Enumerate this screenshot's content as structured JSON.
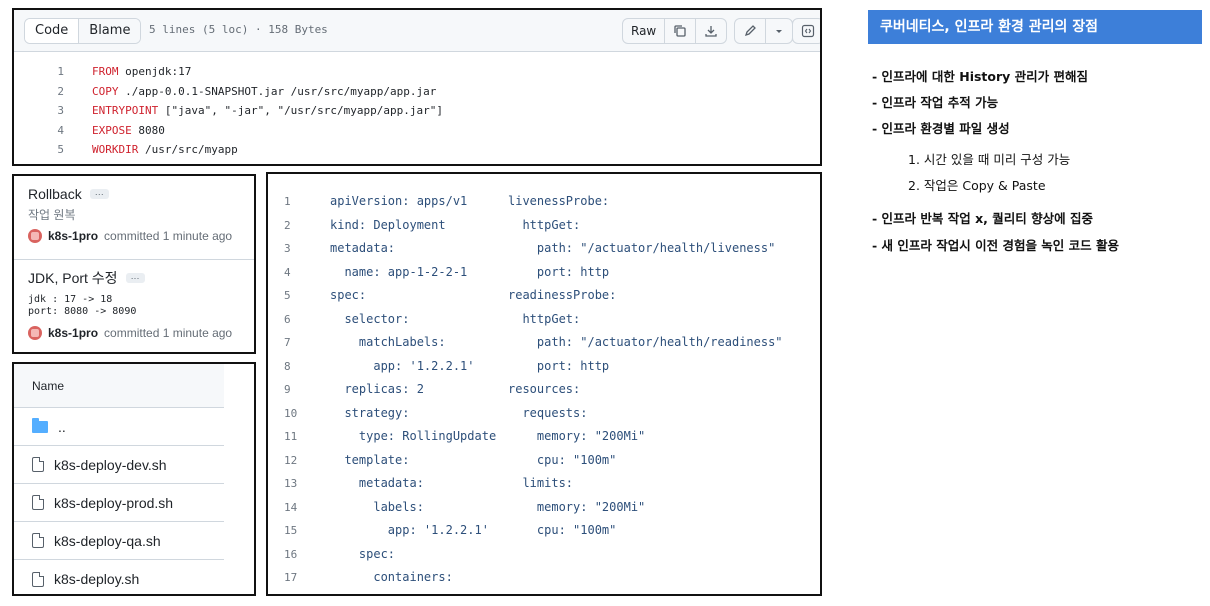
{
  "code_view": {
    "tab_code": "Code",
    "tab_blame": "Blame",
    "meta": "5 lines (5 loc) · 158 Bytes",
    "raw_label": "Raw",
    "lines": [
      {
        "num": "1",
        "kw": "FROM",
        "rest": " openjdk:17"
      },
      {
        "num": "2",
        "kw": "COPY",
        "rest": " ./app-0.0.1-SNAPSHOT.jar /usr/src/myapp/app.jar"
      },
      {
        "num": "3",
        "kw": "ENTRYPOINT",
        "rest": " [\"java\", \"-jar\", \"/usr/src/myapp/app.jar\"]"
      },
      {
        "num": "4",
        "kw": "EXPOSE",
        "rest": " 8080"
      },
      {
        "num": "5",
        "kw": "WORKDIR",
        "rest": " /usr/src/myapp"
      }
    ]
  },
  "commits": [
    {
      "title": "Rollback",
      "desc": "작업 원복",
      "author": "k8s-1pro",
      "time": "committed 1 minute ago"
    },
    {
      "title": "JDK, Port 수정",
      "desc": "jdk : 17 -> 18\nport: 8080 -> 8090",
      "author": "k8s-1pro",
      "time": "committed 1 minute ago"
    }
  ],
  "files": {
    "header": "Name",
    "parent": "..",
    "items": [
      "k8s-deploy-dev.sh",
      "k8s-deploy-prod.sh",
      "k8s-deploy-qa.sh",
      "k8s-deploy.sh"
    ]
  },
  "yaml_left": {
    "line_numbers": [
      "1",
      "2",
      "3",
      "4",
      "5",
      "6",
      "7",
      "8",
      "9",
      "10",
      "11",
      "12",
      "13",
      "14",
      "15",
      "16",
      "17"
    ],
    "lines": [
      "apiVersion: apps/v1",
      "kind: Deployment",
      "metadata:",
      "  name: app-1-2-2-1",
      "spec:",
      "  selector:",
      "    matchLabels:",
      "      app: '1.2.2.1'",
      "  replicas: 2",
      "  strategy:",
      "    type: RollingUpdate",
      "  template:",
      "    metadata:",
      "      labels:",
      "        app: '1.2.2.1'",
      "    spec:",
      "      containers:"
    ]
  },
  "yaml_right": {
    "lines": [
      "livenessProbe:",
      "  httpGet:",
      "    path: \"/actuator/health/liveness\"",
      "    port: http",
      "readinessProbe:",
      "  httpGet:",
      "    path: \"/actuator/health/readiness\"",
      "    port: http",
      "resources:",
      "  requests:",
      "    memory: \"200Mi\"",
      "    cpu: \"100m\"",
      "  limits:",
      "    memory: \"200Mi\"",
      "    cpu: \"100m\""
    ]
  },
  "notes": {
    "title": "쿠버네티스, 인프라 환경 관리의 장점",
    "items": [
      "- 인프라에 대한 History 관리가 편해짐",
      "- 인프라 작업 추적 가능",
      "- 인프라 환경별 파일 생성",
      "1. 시간 있을 때 미리 구성 가능",
      "2. 작업은 Copy & Paste",
      "- 인프라 반복 작업 x, 퀄리티 향상에 집중",
      "- 새 인프라 작업시 이전 경험을 녹인 코드 활용"
    ]
  },
  "colors": {
    "accent": "#3d7fd9",
    "keyword": "#cf222e"
  }
}
